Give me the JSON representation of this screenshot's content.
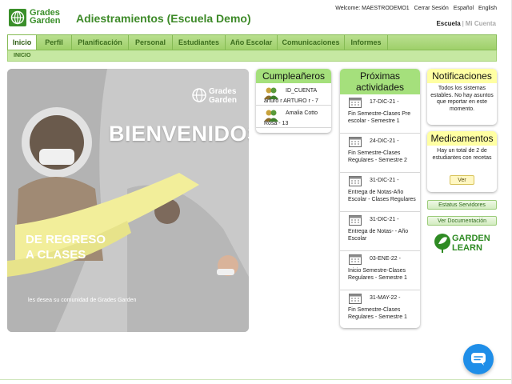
{
  "header": {
    "logo_line1": "Grades",
    "logo_line2": "Garden",
    "title": "Adiestramientos (Escuela Demo)",
    "welcome": "Welcome: MAESTRODEMO1",
    "logout": "Cerrar Sesión",
    "lang_es": "Español",
    "lang_en": "English",
    "school": "Escuela",
    "separator": "|",
    "my_account": "Mi Cuenta"
  },
  "nav": {
    "tabs": [
      {
        "label": "Inicio",
        "active": true
      },
      {
        "label": "Perfil"
      },
      {
        "label": "Planificación"
      },
      {
        "label": "Personal"
      },
      {
        "label": "Estudiantes"
      },
      {
        "label": "Año Escolar"
      },
      {
        "label": "Comunicaciones"
      },
      {
        "label": "Informes"
      }
    ],
    "breadcrumb": "INICIO"
  },
  "banner": {
    "brand_line1": "Grades",
    "brand_line2": "Garden",
    "title": "BIENVENIDOS",
    "subtitle": "DE REGRESO\nA CLASES",
    "footer": "les desea su comunidad de Grades Garden"
  },
  "birthdays": {
    "title": "Cumpleañeros",
    "items": [
      {
        "name": "ID_CUENTA",
        "detail": "arturo r ARTURO r - 7"
      },
      {
        "name": "Amalia Cotto",
        "detail": "Rosa - 13"
      }
    ]
  },
  "activities": {
    "title": "Próximas actividades",
    "items": [
      {
        "date": "17-DIC-21 -",
        "desc": "Fin Semestre-Clases Pre escolar - Semestre 1"
      },
      {
        "date": "24-DIC-21 -",
        "desc": "Fin Semestre-Clases Regulares - Semestre 2"
      },
      {
        "date": "31-DIC-21 -",
        "desc": "Entrega de Notas-Año Escolar - Clases Regulares"
      },
      {
        "date": "31-DIC-21 -",
        "desc": "Entrega de Notas- - Año Escolar"
      },
      {
        "date": "03-ENE-22 -",
        "desc": "Inicio Semestre-Clases Regulares - Semestre 1"
      },
      {
        "date": "31-MAY-22 -",
        "desc": "Fin Semestre-Clases Regulares - Semestre 1"
      }
    ]
  },
  "notifications": {
    "title": "Notificaciones",
    "body": "Todos los sistemas estables. No hay asuntos que reportar en este momento."
  },
  "medications": {
    "title": "Medicamentos",
    "body": "Hay un total de 2 de estudiantes con recetas",
    "button": "Ver"
  },
  "side_buttons": {
    "status": "Estatus Servidores",
    "docs": "Ver Documentación"
  },
  "garden_learn": {
    "line1": "GARDEN",
    "line2": "LEARN"
  },
  "colors": {
    "brand_green": "#3d8a28",
    "nav_green": "#9fd06a",
    "card_header_green": "#a5e07c",
    "card_header_yellow": "#ffffa3",
    "chat_blue": "#1f8ee8"
  },
  "icons": {
    "logo": "globe-logo-icon",
    "birthday": "people-icon",
    "activity": "calendar-icon",
    "chat": "chat-bubble-icon"
  }
}
